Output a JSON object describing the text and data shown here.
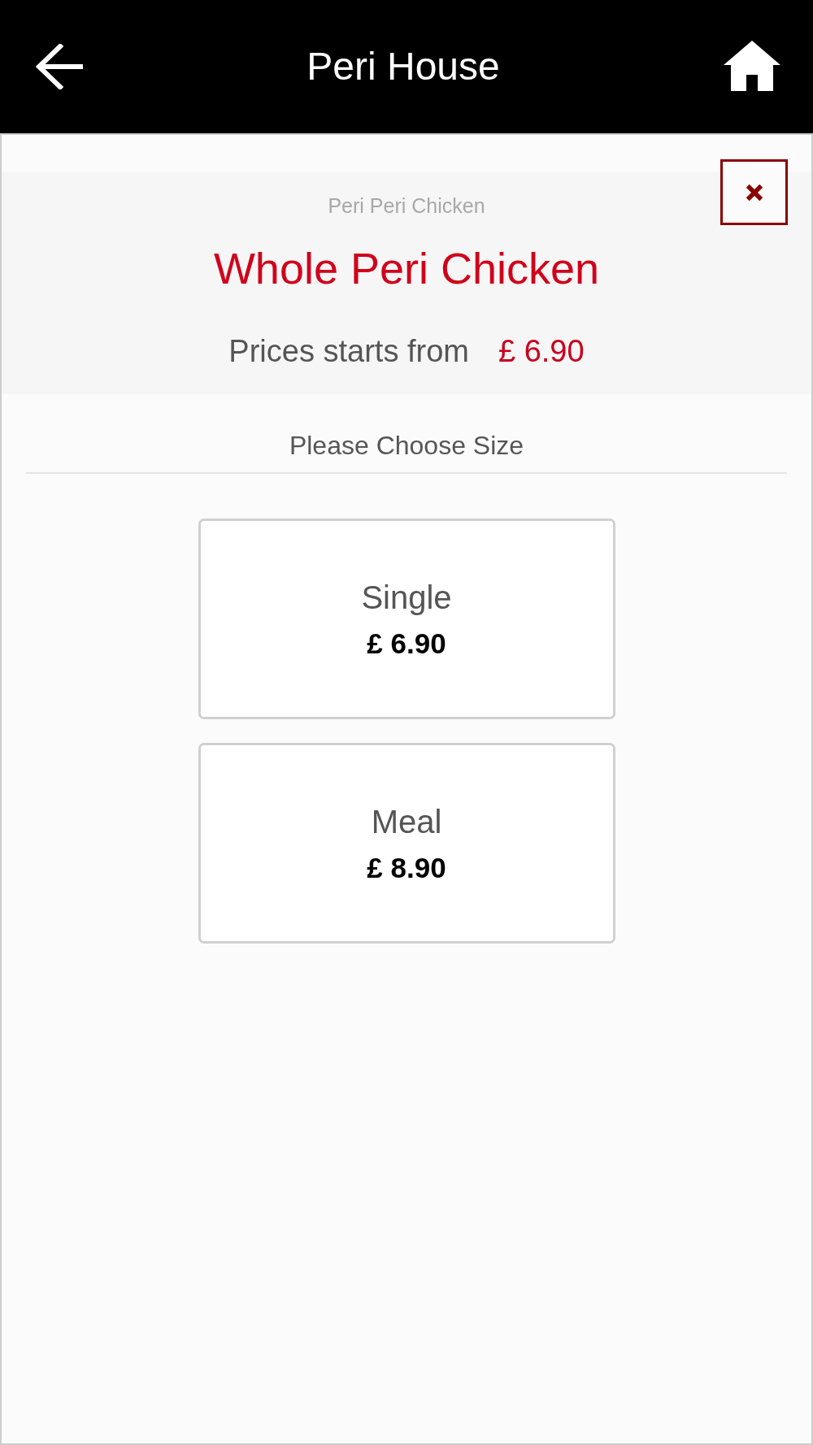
{
  "header": {
    "title": "Peri House"
  },
  "item": {
    "category": "Peri Peri Chicken",
    "name": "Whole Peri Chicken",
    "price_label": "Prices starts from",
    "price": "£ 6.90"
  },
  "size_section": {
    "heading": "Please Choose Size",
    "options": [
      {
        "name": "Single",
        "price": "£ 6.90"
      },
      {
        "name": "Meal",
        "price": "£ 8.90"
      }
    ]
  }
}
